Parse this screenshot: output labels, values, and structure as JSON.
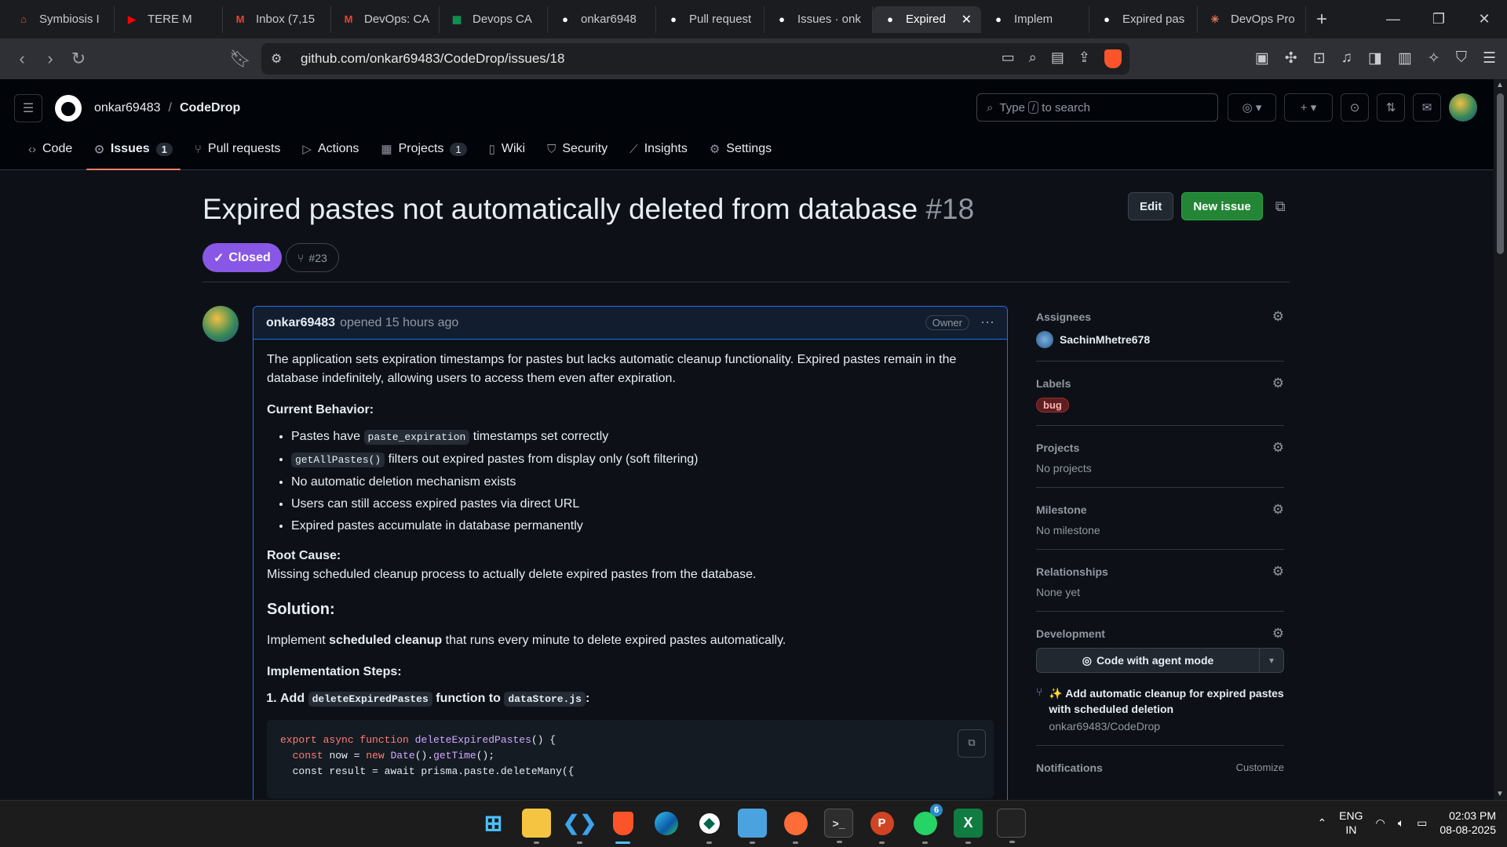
{
  "browser": {
    "tabs": [
      {
        "title": "Symbiosis I",
        "icon": "symbiosis-icon",
        "color": "#e8582d"
      },
      {
        "title": "TERE M",
        "icon": "youtube-icon",
        "color": "#ff0000"
      },
      {
        "title": "Inbox (7,15",
        "icon": "gmail-icon",
        "color": "#ea4335"
      },
      {
        "title": "DevOps: CA",
        "icon": "gmail-icon",
        "color": "#ea4335"
      },
      {
        "title": "Devops CA",
        "icon": "sheets-icon",
        "color": "#0f9d58"
      },
      {
        "title": "onkar6948",
        "icon": "github-icon",
        "color": "#ffffff"
      },
      {
        "title": "Pull request",
        "icon": "github-icon",
        "color": "#ffffff"
      },
      {
        "title": "Issues · onk",
        "icon": "github-icon",
        "color": "#ffffff"
      },
      {
        "title": "Expired",
        "icon": "github-icon",
        "color": "#ffffff",
        "active": true
      },
      {
        "title": "Implem",
        "icon": "github-icon",
        "color": "#ffffff"
      },
      {
        "title": "Expired pas",
        "icon": "github-icon",
        "color": "#ffffff"
      },
      {
        "title": "DevOps Pro",
        "icon": "claude-icon",
        "color": "#d97757"
      }
    ],
    "url": "github.com/onkar69483/CodeDrop/issues/18"
  },
  "header": {
    "owner": "onkar69483",
    "repo": "CodeDrop",
    "search_prefix": "Type",
    "search_key": "/",
    "search_suffix": "to search"
  },
  "repo_nav": [
    {
      "label": "Code",
      "icon": "code-icon"
    },
    {
      "label": "Issues",
      "icon": "issue-icon",
      "count": "1",
      "selected": true
    },
    {
      "label": "Pull requests",
      "icon": "pull-request-icon"
    },
    {
      "label": "Actions",
      "icon": "actions-icon"
    },
    {
      "label": "Projects",
      "icon": "projects-icon",
      "count": "1"
    },
    {
      "label": "Wiki",
      "icon": "book-icon"
    },
    {
      "label": "Security",
      "icon": "shield-icon"
    },
    {
      "label": "Insights",
      "icon": "graph-icon"
    },
    {
      "label": "Settings",
      "icon": "gear-icon"
    }
  ],
  "issue": {
    "title": "Expired pastes not automatically deleted from database",
    "number": "#18",
    "state": "Closed",
    "linked_pr": "#23",
    "edit_label": "Edit",
    "new_issue_label": "New issue"
  },
  "comment": {
    "author": "onkar69483",
    "meta": "opened 15 hours ago",
    "role": "Owner",
    "intro": "The application sets expiration timestamps for pastes but lacks automatic cleanup functionality. Expired pastes remain in the database indefinitely, allowing users to access them even after expiration.",
    "current_behavior_heading": "Current Behavior:",
    "b1_pre": "Pastes have",
    "b1_code": "paste_expiration",
    "b1_post": "timestamps set correctly",
    "b2_code": "getAllPastes()",
    "b2_post": "filters out expired pastes from display only (soft filtering)",
    "b3": "No automatic deletion mechanism exists",
    "b4": "Users can still access expired pastes via direct URL",
    "b5": "Expired pastes accumulate in database permanently",
    "root_cause_heading": "Root Cause:",
    "root_cause": "Missing scheduled cleanup process to actually delete expired pastes from the database.",
    "solution_heading": "Solution:",
    "sol_pre": "Implement",
    "sol_bold": "scheduled cleanup",
    "sol_post": "that runs every minute to delete expired pastes automatically.",
    "impl_heading": "Implementation Steps:",
    "step1_pre": "Add",
    "step1_code1": "deleteExpiredPastes",
    "step1_mid": "function to",
    "step1_code2": "dataStore.js",
    "step1_post": ":",
    "code_line1_kw": "export async function",
    "code_line1_fn": "deleteExpiredPastes",
    "code_line1_rest": "() {",
    "code_line2_kw1": "const",
    "code_line2_a": "now =",
    "code_line2_kw2": "new",
    "code_line2_fn": "Date",
    "code_line2_b": "().",
    "code_line2_fn2": "getTime",
    "code_line2_c": "();",
    "code_line3": "const result = await prisma.paste.deleteMany({"
  },
  "sidebar": {
    "assignees_title": "Assignees",
    "assignee": "SachinMhetre678",
    "labels_title": "Labels",
    "label": "bug",
    "projects_title": "Projects",
    "projects_value": "No projects",
    "milestone_title": "Milestone",
    "milestone_value": "No milestone",
    "relationships_title": "Relationships",
    "relationships_value": "None yet",
    "development_title": "Development",
    "agent_button": "Code with agent mode",
    "dev_pr_title": "✨ Add automatic cleanup for expired pastes with scheduled deletion",
    "dev_pr_repo": "onkar69483/CodeDrop",
    "notifications_title": "Notifications",
    "customize": "Customize"
  },
  "taskbar": {
    "lang1": "ENG",
    "lang2": "IN",
    "time": "02:03 PM",
    "date": "08-08-2025",
    "whatsapp_badge": "6"
  }
}
